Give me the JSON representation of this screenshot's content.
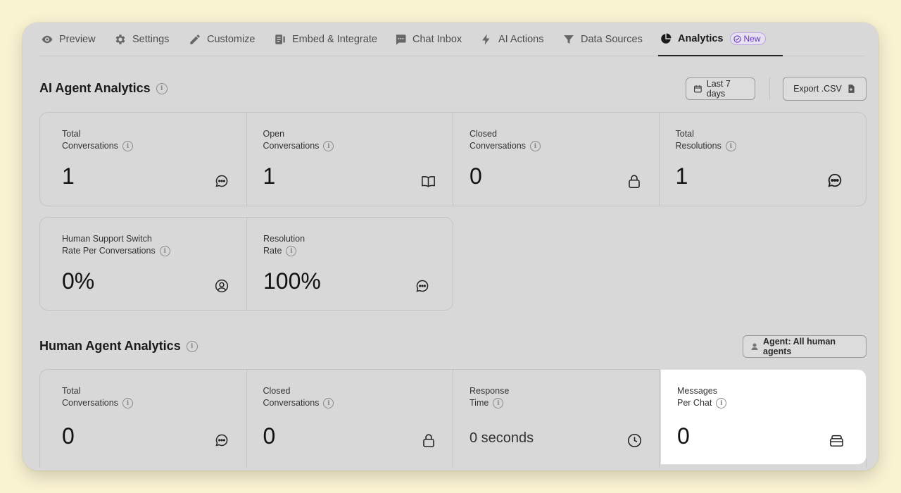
{
  "tabs": [
    {
      "label": "Preview",
      "icon": "eye-icon"
    },
    {
      "label": "Settings",
      "icon": "gear-icon"
    },
    {
      "label": "Customize",
      "icon": "pencil-icon"
    },
    {
      "label": "Embed & Integrate",
      "icon": "embed-icon"
    },
    {
      "label": "Chat Inbox",
      "icon": "chat-inbox-icon"
    },
    {
      "label": "AI Actions",
      "icon": "lightning-icon"
    },
    {
      "label": "Data Sources",
      "icon": "filter-icon"
    },
    {
      "label": "Analytics",
      "icon": "pie-chart-icon",
      "active": true,
      "badge": "New"
    }
  ],
  "ai_section": {
    "title": "AI Agent Analytics",
    "date_button": "Last 7 days",
    "export_button": "Export .CSV",
    "cards": [
      {
        "line1": "Total",
        "line2": "Conversations",
        "value": "1",
        "icon": "chat-bubble-icon"
      },
      {
        "line1": "Open",
        "line2": "Conversations",
        "value": "1",
        "icon": "book-icon"
      },
      {
        "line1": "Closed",
        "line2": "Conversations",
        "value": "0",
        "icon": "lock-icon"
      },
      {
        "line1": "Total",
        "line2": "Resolutions",
        "value": "1",
        "icon": "chat-bubble-icon"
      },
      {
        "line1": "Human Support Switch",
        "line2": "Rate Per Conversations",
        "value": "0%",
        "icon": "user-circle-icon"
      },
      {
        "line1": "Resolution",
        "line2": "Rate",
        "value": "100%",
        "icon": "chat-bubble-icon"
      }
    ]
  },
  "human_section": {
    "title": "Human Agent Analytics",
    "agent_button": "Agent: All human agents",
    "cards": [
      {
        "line1": "Total",
        "line2": "Conversations",
        "value": "0",
        "icon": "chat-bubble-icon"
      },
      {
        "line1": "Closed",
        "line2": "Conversations",
        "value": "0",
        "icon": "lock-icon"
      },
      {
        "line1": "Response",
        "line2": "Time",
        "value": "0 seconds",
        "icon": "clock-icon"
      },
      {
        "line1": "Messages",
        "line2": "Per Chat",
        "value": "0",
        "icon": "inbox-icon"
      }
    ]
  },
  "colors": {
    "background": "#faf3d2",
    "window": "#d8d8d8",
    "badge": "#6a3cc7"
  }
}
